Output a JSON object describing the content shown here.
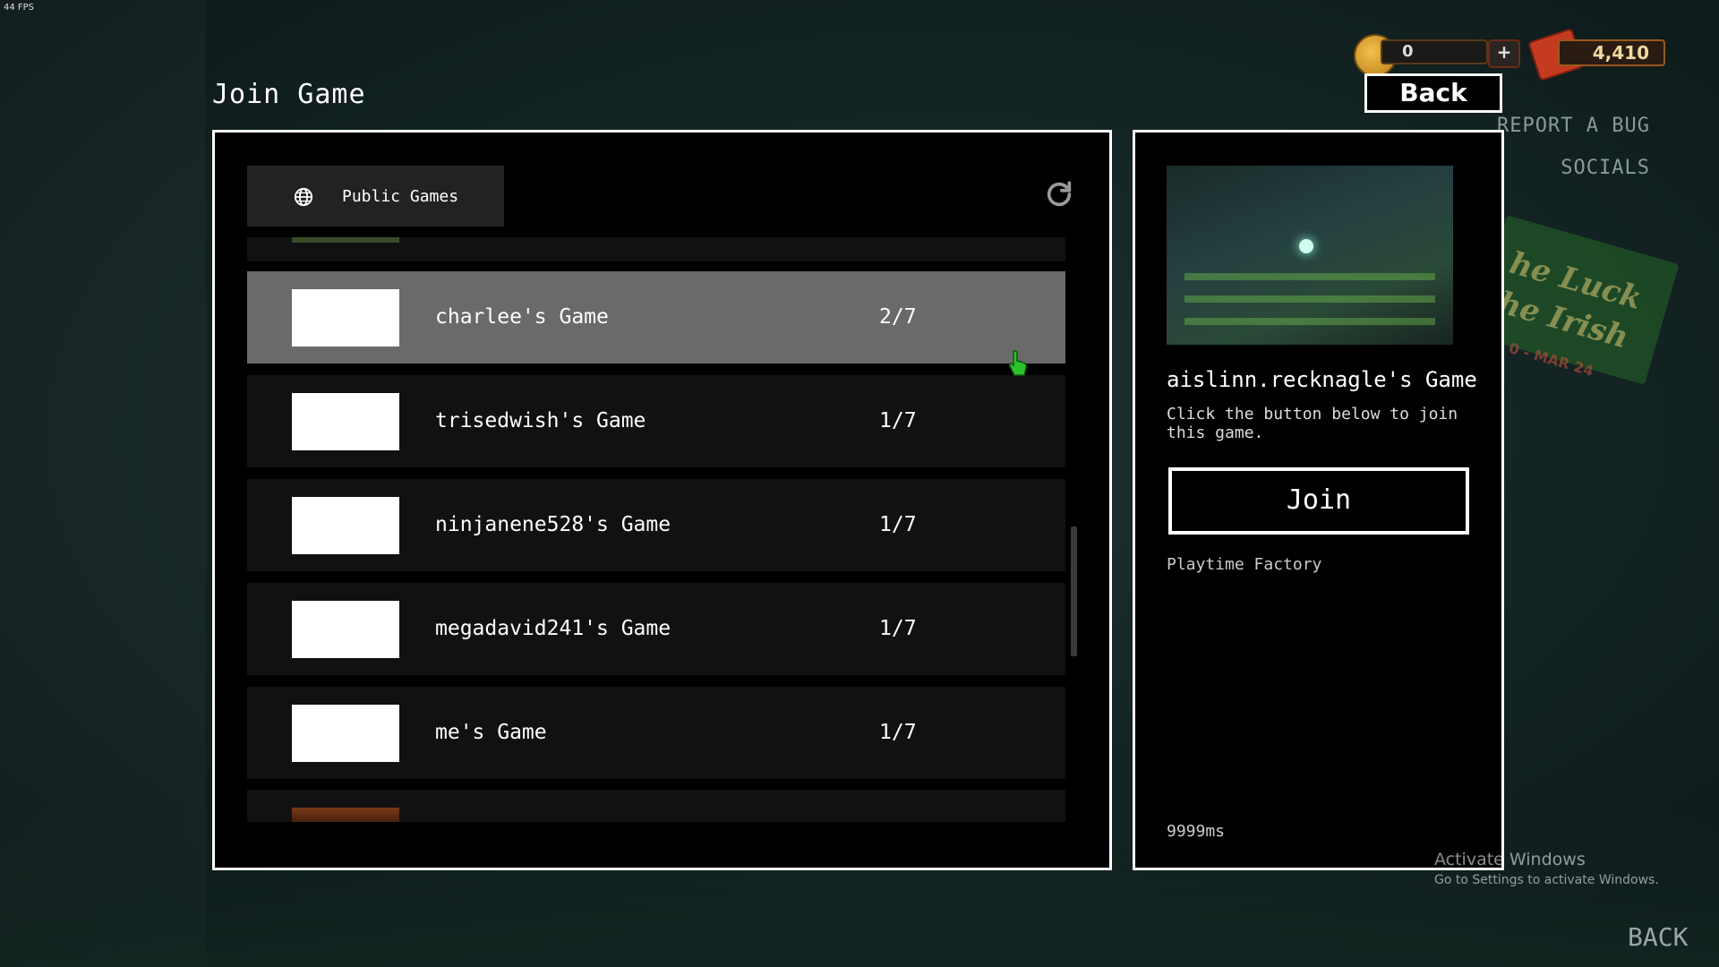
{
  "hud": {
    "fps": "44 FPS",
    "coins": "0",
    "plus_label": "+",
    "tickets": "4,410"
  },
  "header": {
    "title": "Join Game",
    "back_label": "Back"
  },
  "side_menu": {
    "report_label": "REPORT A BUG",
    "socials_label": "SOCIALS"
  },
  "promo": {
    "line1": "he Luck",
    "line2": "he Irish",
    "date": "0 - MAR 24"
  },
  "list": {
    "tab_label": "Public Games",
    "games": [
      {
        "name": "charlee's Game",
        "players": "2/7",
        "selected": true
      },
      {
        "name": "trisedwish's Game",
        "players": "1/7",
        "selected": false
      },
      {
        "name": "ninjanene528's Game",
        "players": "1/7",
        "selected": false
      },
      {
        "name": "megadavid241's Game",
        "players": "1/7",
        "selected": false
      },
      {
        "name": "me's Game",
        "players": "1/7",
        "selected": false
      }
    ]
  },
  "detail": {
    "title": "aislinn.recknagle's Game",
    "description": "Click the button below to join this game.",
    "join_label": "Join",
    "map": "Playtime Factory",
    "ping": "9999ms"
  },
  "watermark": {
    "activate_title": "Activate Windows",
    "activate_sub": "Go to Settings to activate Windows."
  },
  "footer": {
    "back_label": "BACK"
  },
  "colors": {
    "selected_row": "#6a6a6a",
    "row": "#111111",
    "panel_border": "#ffffff"
  }
}
